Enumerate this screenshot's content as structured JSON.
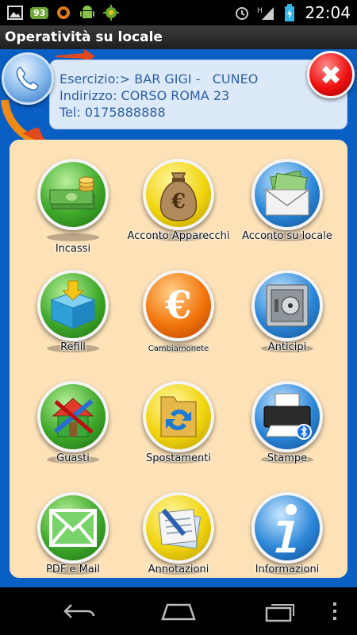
{
  "status_bar": {
    "notification_badge": "93",
    "time": "22:04",
    "icons": [
      "image-icon",
      "sync-icon",
      "android-icon",
      "bug-icon",
      "alarm-icon",
      "signal-icon",
      "battery-icon"
    ]
  },
  "title_bar": {
    "title": "Operatività su locale"
  },
  "header": {
    "esercizio_line": "Esercizio:> BAR GIGI -   CUNEO",
    "indirizzo_line": "Indirizzo: CORSO ROMA 23",
    "tel_line": "Tel: 0175888888"
  },
  "tiles": [
    {
      "label": "Incassi",
      "icon": "cash-money-icon",
      "color": "green"
    },
    {
      "label": "Acconto Apparecchi",
      "icon": "money-bag-icon",
      "color": "yellow"
    },
    {
      "label": "Acconto su locale",
      "icon": "envelope-cash-icon",
      "color": "blue"
    },
    {
      "label": "Refill",
      "icon": "box-download-icon",
      "color": "green"
    },
    {
      "label": "Cambiamonete",
      "icon": "euro-icon",
      "color": "orange"
    },
    {
      "label": "Anticipi",
      "icon": "safe-icon",
      "color": "blue"
    },
    {
      "label": "Guasti",
      "icon": "house-tools-icon",
      "color": "green"
    },
    {
      "label": "Spostamenti",
      "icon": "folder-transfer-icon",
      "color": "yellow"
    },
    {
      "label": "Stampe",
      "icon": "printer-bluetooth-icon",
      "color": "blue"
    },
    {
      "label": "PDF e Mail",
      "icon": "mail-icon",
      "color": "green"
    },
    {
      "label": "Annotazioni",
      "icon": "notes-pen-icon",
      "color": "yellow"
    },
    {
      "label": "Informazioni",
      "icon": "info-icon",
      "color": "blue"
    }
  ],
  "colors": {
    "background": "#0a5fc4",
    "panel": "#fde2b8",
    "header_text": "#2e5fa3",
    "header_card": "#dce9f8"
  }
}
